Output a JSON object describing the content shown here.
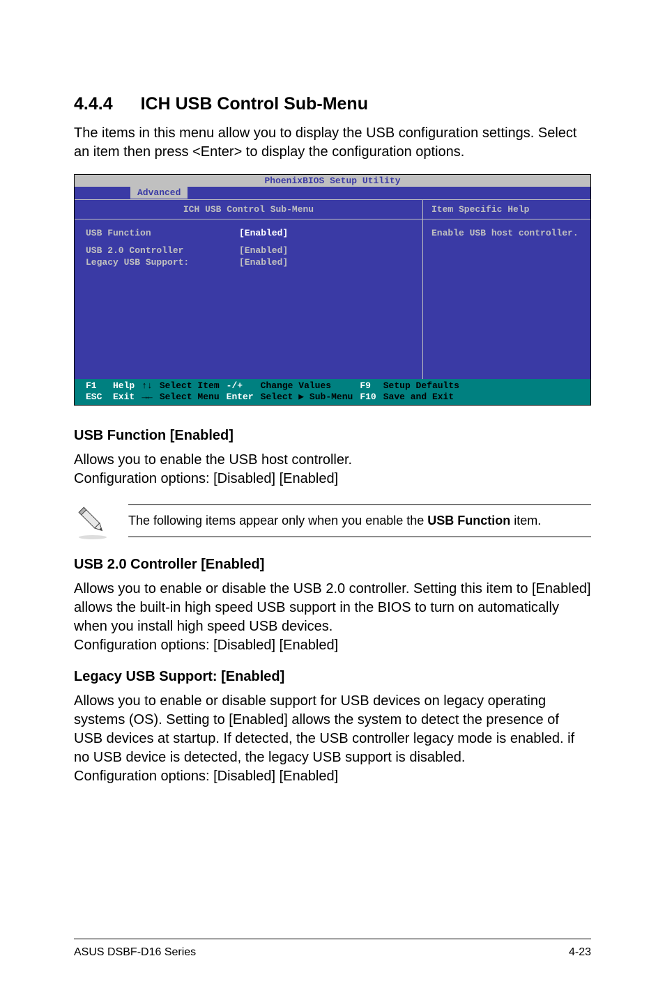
{
  "section": {
    "number": "4.4.4",
    "title": "ICH USB Control Sub-Menu",
    "intro": "The items in this menu allow you to display the USB configuration settings. Select an item then press <Enter> to display the configuration options."
  },
  "bios": {
    "title": "PhoenixBIOS Setup Utility",
    "tab": "Advanced",
    "panel_title": "ICH USB Control Sub-Menu",
    "help_title": "Item Specific Help",
    "help_text": "Enable USB host controller.",
    "fields": [
      {
        "label": "USB Function",
        "value": "[Enabled]",
        "highlight": true
      },
      {
        "label": "USB 2.0 Controller",
        "value": "[Enabled]",
        "highlight": false
      },
      {
        "label": "Legacy USB Support:",
        "value": "[Enabled]",
        "highlight": false
      }
    ],
    "footer": {
      "col1": "F1   Help\nESC  Exit",
      "col2": "↑↓\n→←",
      "col3": "Select Item\nSelect Menu",
      "col4": "-/+\nEnter",
      "col5": "Change Values\nSelect ▶ Sub-Menu",
      "col6": "F9\nF10",
      "col7": "Setup Defaults\nSave and Exit"
    }
  },
  "subsections": [
    {
      "heading": "USB Function [Enabled]",
      "body": "Allows you to enable the USB host controller.\nConfiguration options: [Disabled] [Enabled]"
    },
    {
      "heading": "USB 2.0 Controller [Enabled]",
      "body": "Allows you to enable or disable the USB 2.0 controller. Setting this item to [Enabled] allows the built-in high speed USB support in the BIOS to turn on automatically when you install high speed USB devices.\nConfiguration options: [Disabled] [Enabled]"
    },
    {
      "heading": "Legacy USB Support: [Enabled]",
      "body": "Allows you to enable or disable support for USB devices on legacy operating systems (OS). Setting to [Enabled] allows the system to detect the presence of USB devices at startup. If detected, the USB controller legacy mode is enabled. if no USB device is detected, the legacy USB support is disabled.\nConfiguration options: [Disabled] [Enabled]"
    }
  ],
  "note": {
    "prefix": "The following items appear only when you enable the ",
    "bold": "USB Function",
    "suffix": " item."
  },
  "footer": {
    "left": "ASUS DSBF-D16 Series",
    "right": "4-23"
  }
}
